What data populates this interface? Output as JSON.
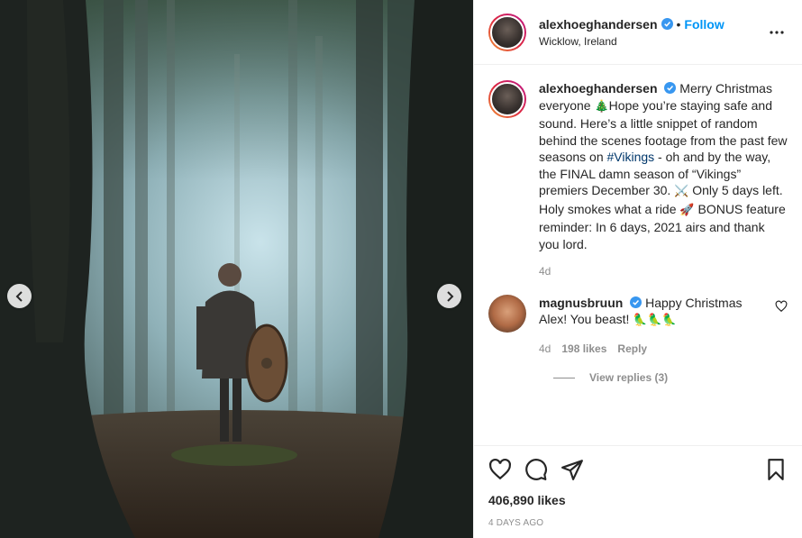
{
  "post": {
    "author": {
      "username": "alexhoeghandersen",
      "follow_label": "Follow",
      "dot": "•",
      "location": "Wicklow, Ireland"
    },
    "more_label": "•••",
    "caption": {
      "username": "alexhoeghandersen",
      "text_1": "Merry Christmas everyone ",
      "emoji_tree": "🎄",
      "text_2": "Hope you’re staying safe and sound. Here’s a little snippet of random behind the scenes footage from the past few seasons on ",
      "hashtag": "#Vikings",
      "text_3": " - oh and by the way, the FINAL damn season of “Vikings” premiers December 30. ",
      "emoji_swords": "⚔️",
      "text_4": " Only 5 days left. Holy smokes what a ride ",
      "emoji_rocket": "🚀",
      "text_5": " BONUS feature reminder: In 6 days, 2021 airs and thank you lord.",
      "age": "4d"
    },
    "comment": {
      "username": "magnusbruun",
      "text": "Happy Christmas Alex! You beast! ",
      "emojis": "🦜🦜🦜",
      "age": "4d",
      "likes": "198 likes",
      "reply_label": "Reply",
      "view_replies": "View replies (3)"
    },
    "likes": "406,890 likes",
    "timestamp": "4 DAYS AGO"
  },
  "icons": {
    "prev": "chevron-left-icon",
    "next": "chevron-right-icon",
    "like": "heart-icon",
    "comment": "comment-icon",
    "share": "paper-plane-icon",
    "save": "bookmark-icon",
    "verified": "verified-badge-icon"
  },
  "colors": {
    "link_blue": "#0095f6",
    "hashtag": "#00376b",
    "muted": "#8e8e8e",
    "text": "#262626"
  }
}
